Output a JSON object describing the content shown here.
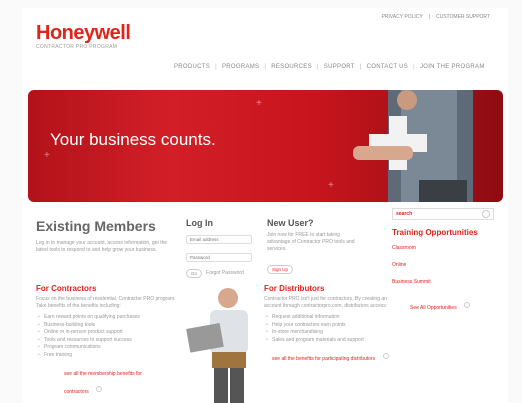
{
  "header": {
    "brand": "Honeywell",
    "tagline": "CONTRACTOR PRO PROGRAM",
    "top_links": [
      "PRIVACY POLICY",
      "CUSTOMER SUPPORT"
    ]
  },
  "nav": {
    "items": [
      "PRODUCTS",
      "PROGRAMS",
      "RESOURCES",
      "SUPPORT",
      "CONTACT US",
      "JOIN THE PROGRAM"
    ]
  },
  "hero": {
    "slogan": "Your business counts."
  },
  "search": {
    "label": "search"
  },
  "existing": {
    "title": "Existing Members",
    "text": "Log in to manage your account, access information, get the latest tools to respond to and help grow your business."
  },
  "login": {
    "title": "Log In",
    "user_placeholder": "Email address",
    "pass_placeholder": "Password",
    "button": "Go",
    "forgot": "Forgot Password"
  },
  "new_user": {
    "title": "New User?",
    "text": "Join now for FREE to start taking advantage of Contractor PRO tools and services.",
    "button": "Sign Up"
  },
  "training": {
    "title": "Training Opportunities",
    "items": [
      "Classroom",
      "Online",
      "Business Summit"
    ],
    "see_all": "See All Opportunities"
  },
  "contractors": {
    "title": "For Contractors",
    "intro": "Focus on the business of residential. Contractor PRO program. Take benefits of the benefits including:",
    "bullets": [
      "Earn reward points on qualifying purchases",
      "Business-building tools",
      "Online or in-person product support",
      "Tools and resources to support success",
      "Program communications",
      "Free training"
    ],
    "link": "see all the membership benefits for contractors"
  },
  "distributors": {
    "title": "For Distributors",
    "intro": "Contractor PRO isn't just for contractors. By creating an account through contractorpro.com, distributors access:",
    "bullets": [
      "Request additional information",
      "Help your contractors earn points",
      "In-store merchandising",
      "Sales and program materials and support"
    ],
    "link": "see all the benefits for participating distributors"
  }
}
